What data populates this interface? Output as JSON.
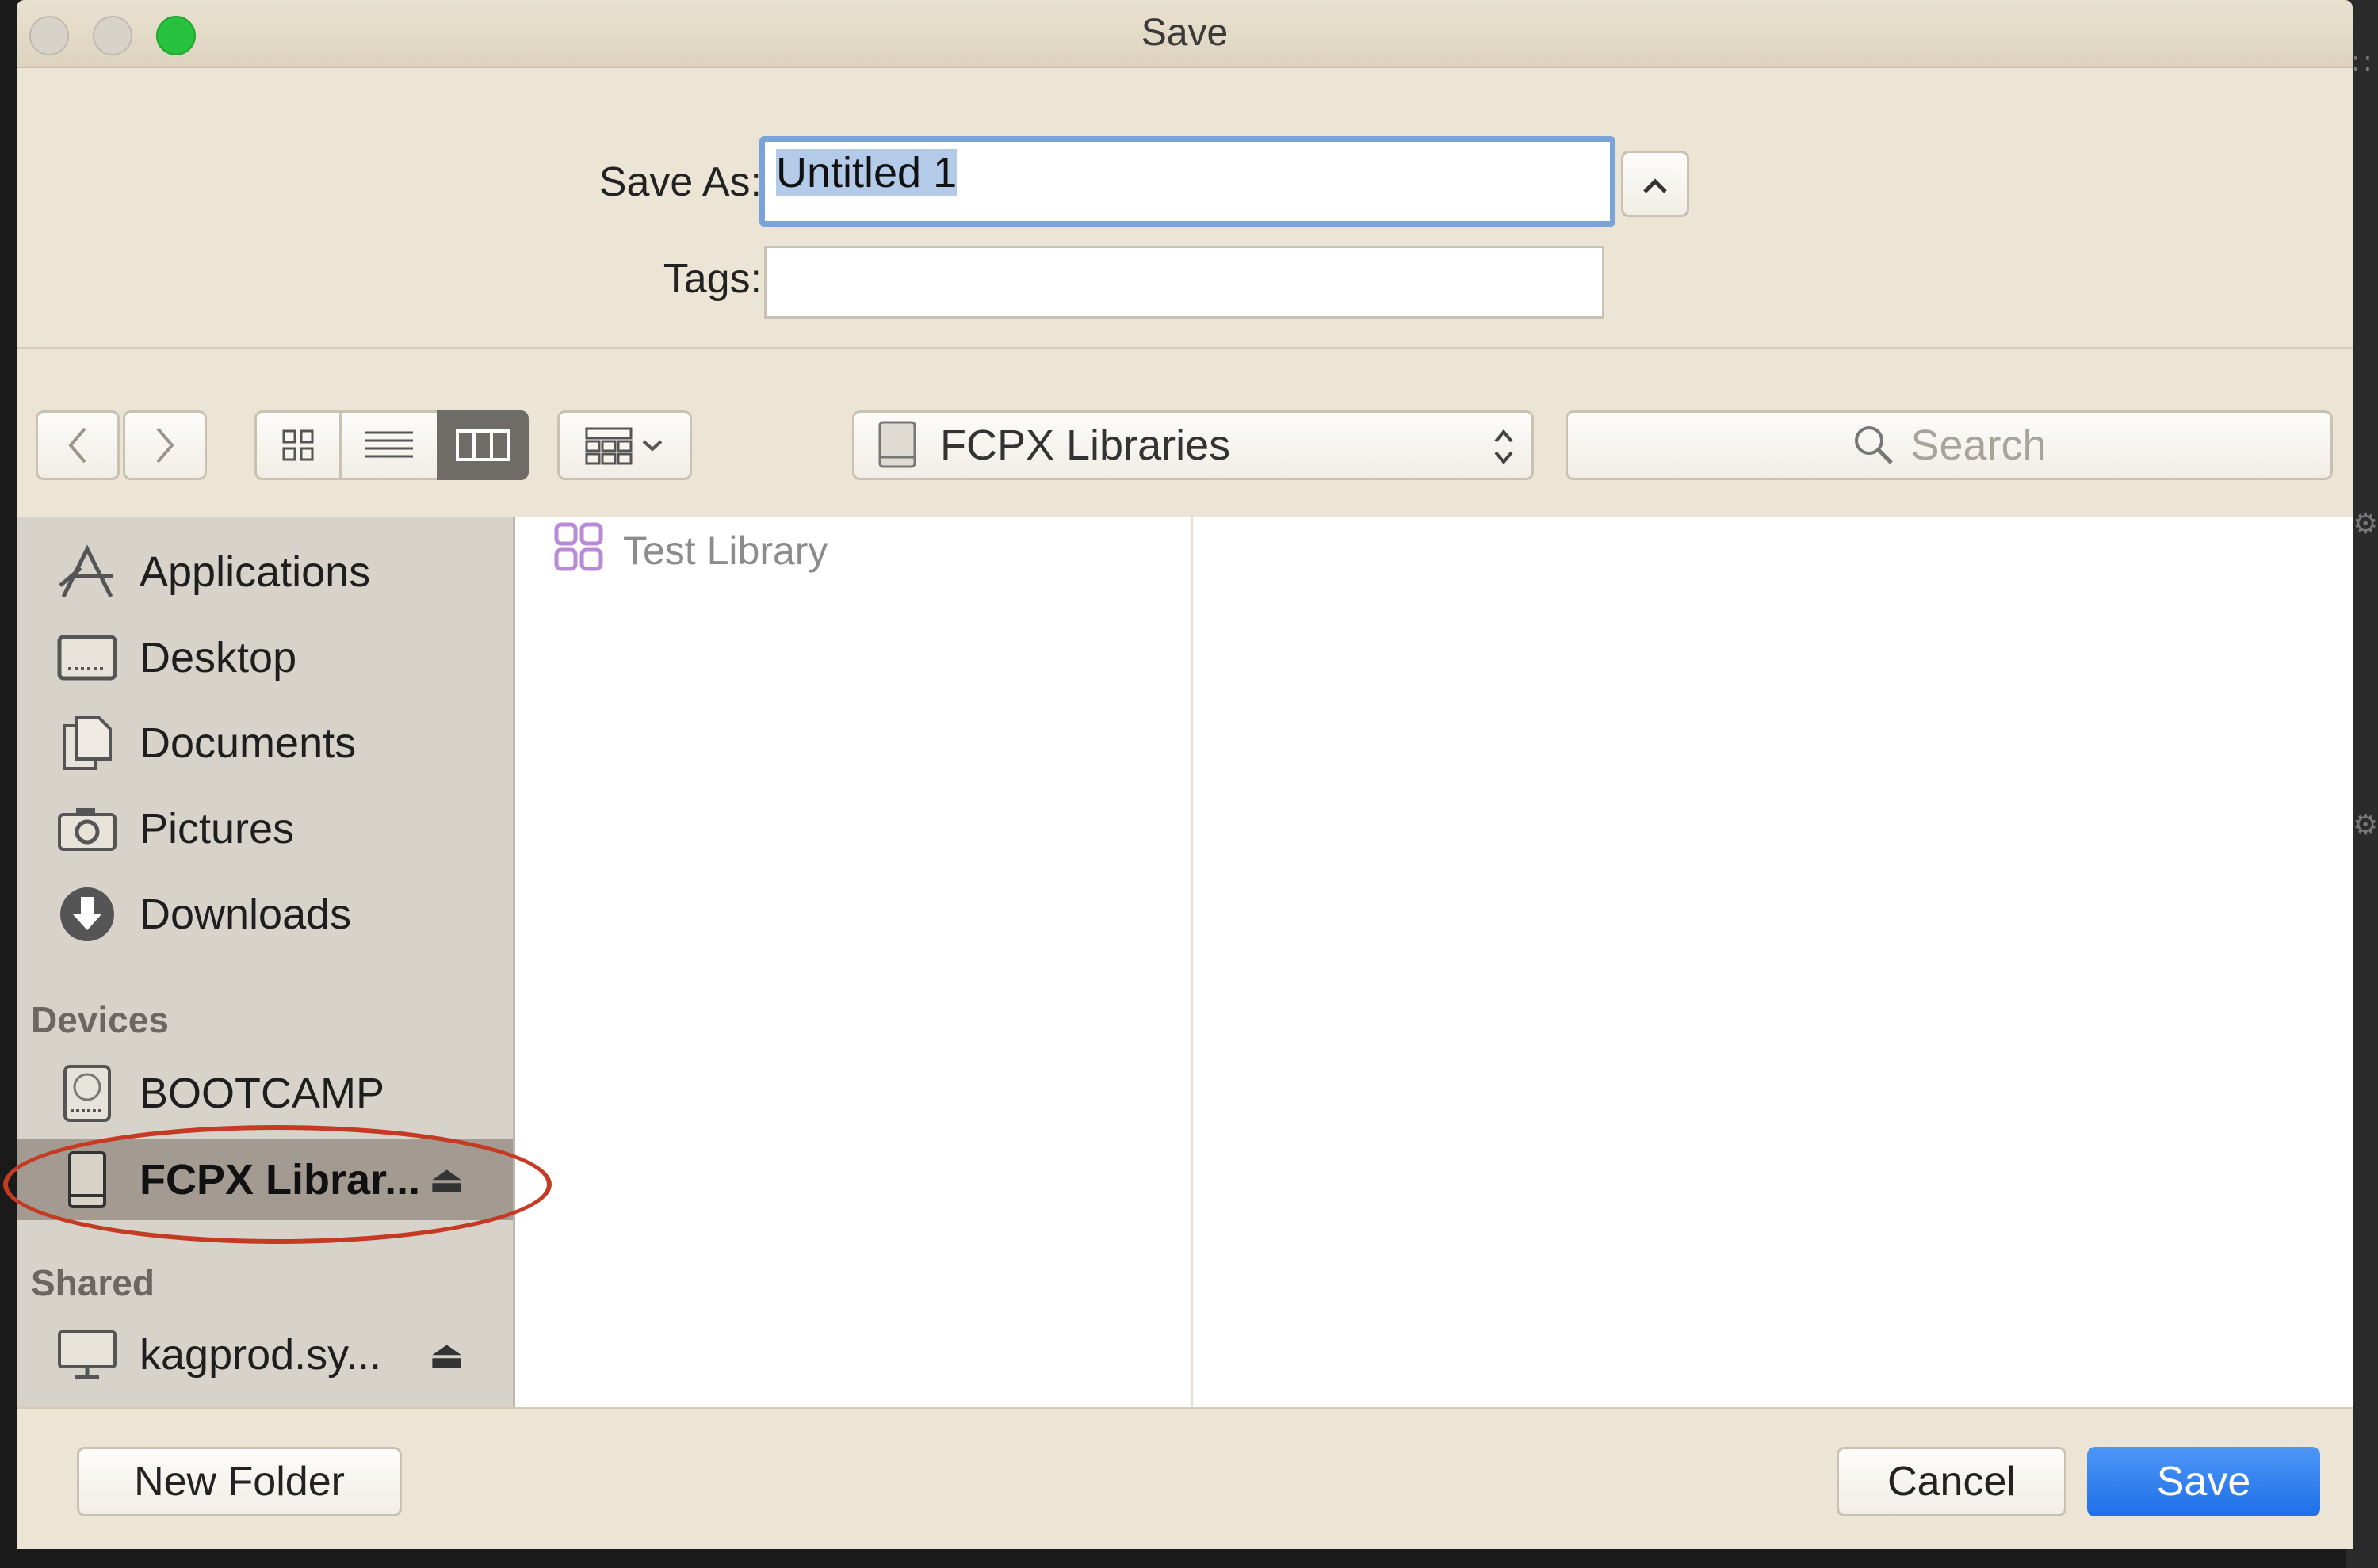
{
  "window": {
    "title": "Save"
  },
  "form": {
    "save_as_label": "Save As:",
    "save_as_value": "Untitled 1",
    "tags_label": "Tags:",
    "tags_value": ""
  },
  "toolbar": {
    "location": "FCPX Libraries",
    "search_placeholder": "Search"
  },
  "sidebar": {
    "favorites": [
      {
        "label": "Applications",
        "icon": "applications-icon"
      },
      {
        "label": "Desktop",
        "icon": "desktop-icon"
      },
      {
        "label": "Documents",
        "icon": "documents-icon"
      },
      {
        "label": "Pictures",
        "icon": "pictures-icon"
      },
      {
        "label": "Downloads",
        "icon": "downloads-icon"
      }
    ],
    "devices_heading": "Devices",
    "devices": [
      {
        "label": "BOOTCAMP",
        "icon": "internal-disk-icon"
      },
      {
        "label": "FCPX Librar...",
        "icon": "external-drive-icon",
        "selected": true
      }
    ],
    "shared_heading": "Shared",
    "shared": [
      {
        "label": "kagprod.sy...",
        "icon": "network-computer-icon"
      }
    ]
  },
  "browser": {
    "column1": [
      {
        "label": "Test Library",
        "icon": "fcpx-library-icon"
      }
    ]
  },
  "buttons": {
    "new_folder": "New Folder",
    "cancel": "Cancel",
    "save": "Save"
  },
  "colors": {
    "traffic_close": "#d7d2ca",
    "traffic_min": "#d7d2ca",
    "traffic_zoom": "#27c13d",
    "accent": "#2f7ff0",
    "annotation": "#c53a23"
  }
}
